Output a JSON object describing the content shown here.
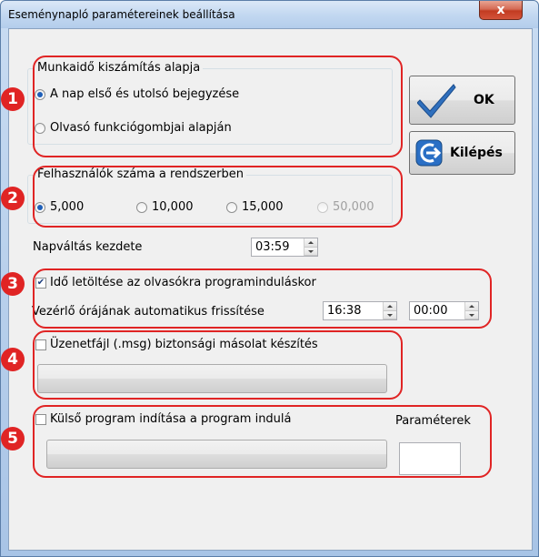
{
  "window": {
    "title": "Eseménynapló paramétereinek beállítása",
    "close_label": "x"
  },
  "group1": {
    "title": "Munkaidő kiszámítás alapja",
    "options": [
      {
        "label": "A nap első és utolsó bejegyzése",
        "selected": true
      },
      {
        "label": "Olvasó funkciógombjai alapján",
        "selected": false
      }
    ]
  },
  "group2": {
    "title": "Felhasználók száma a rendszerben",
    "options": [
      {
        "label": "5,000",
        "selected": true,
        "enabled": true
      },
      {
        "label": "10,000",
        "selected": false,
        "enabled": true
      },
      {
        "label": "15,000",
        "selected": false,
        "enabled": true
      },
      {
        "label": "50,000",
        "selected": false,
        "enabled": false
      }
    ]
  },
  "day_change": {
    "label": "Napváltás kezdete",
    "value": "03:59"
  },
  "section3": {
    "checkbox_label": "Idő letöltése az olvasókra programinduláskor",
    "checked": true,
    "refresh_label": "Vezérlő órájának automatikus frissítése",
    "time1": "16:38",
    "time2": "00:00"
  },
  "section4": {
    "checkbox_label": "Üzenetfájl (.msg) biztonsági másolat készítés",
    "checked": false
  },
  "section5": {
    "checkbox_label": "Külső program indítása a program indulá",
    "checked": false,
    "params_label": "Paraméterek",
    "params_value": ""
  },
  "buttons": {
    "ok_label": "OK",
    "exit_label": "Kilépés"
  },
  "badges": [
    "1",
    "2",
    "3",
    "4",
    "5"
  ],
  "icons": {
    "ok": "checkmark-icon",
    "exit": "exit-arrow-icon"
  },
  "colors": {
    "highlight": "#e02424",
    "badge": "#e02424",
    "radio_selected": "#1e5fb8"
  }
}
